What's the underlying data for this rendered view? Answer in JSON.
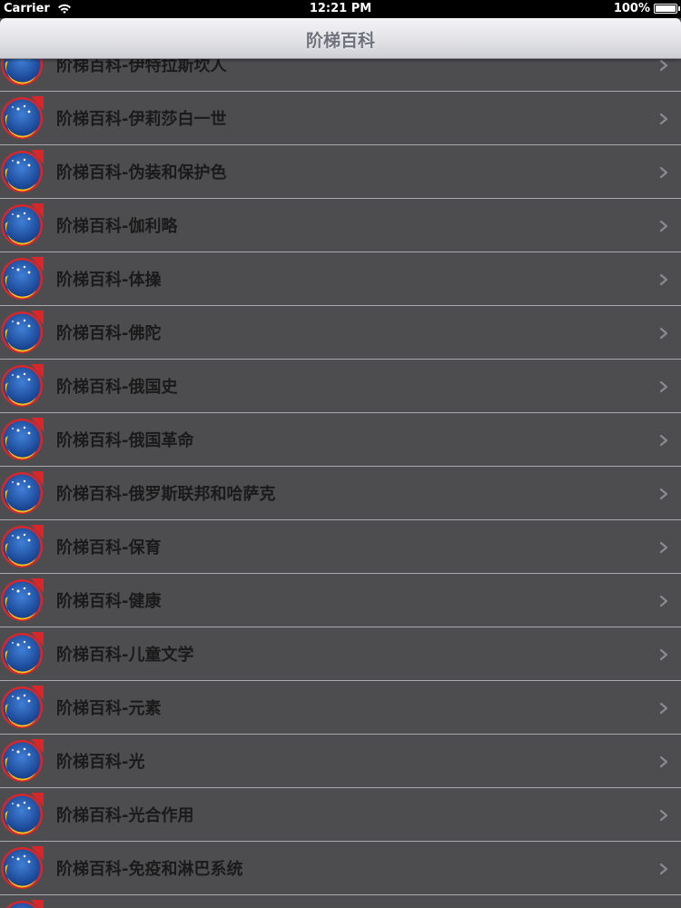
{
  "status_bar": {
    "carrier": "Carrier",
    "time": "12:21 PM",
    "battery": "100%"
  },
  "nav_bar": {
    "title": "阶梯百科"
  },
  "list": {
    "items": [
      {
        "label": "阶梯百科-伊特拉斯坎人"
      },
      {
        "label": "阶梯百科-伊莉莎白一世"
      },
      {
        "label": "阶梯百科-伪装和保护色"
      },
      {
        "label": "阶梯百科-伽利略"
      },
      {
        "label": "阶梯百科-体操"
      },
      {
        "label": "阶梯百科-佛陀"
      },
      {
        "label": "阶梯百科-俄国史"
      },
      {
        "label": "阶梯百科-俄国革命"
      },
      {
        "label": "阶梯百科-俄罗斯联邦和哈萨克"
      },
      {
        "label": "阶梯百科-保育"
      },
      {
        "label": "阶梯百科-健康"
      },
      {
        "label": "阶梯百科-儿童文学"
      },
      {
        "label": "阶梯百科-元素"
      },
      {
        "label": "阶梯百科-光"
      },
      {
        "label": "阶梯百科-光合作用"
      },
      {
        "label": "阶梯百科-免疫和淋巴系统"
      },
      {
        "label": ""
      }
    ]
  },
  "icons": {
    "app_icon": "moon-stars-icon",
    "disclosure": "chevron-right-icon",
    "wifi": "wifi-icon",
    "battery": "battery-icon"
  },
  "colors": {
    "row_background": "#4d4d50",
    "separator": "#a9a9ad",
    "icon_blue": "#1f4fa3",
    "icon_moon": "#f2c21b",
    "icon_red": "#d8262b"
  }
}
